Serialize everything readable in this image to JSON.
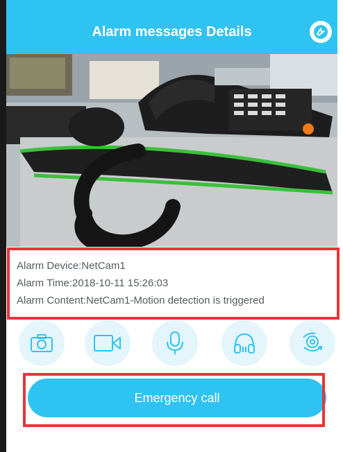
{
  "header": {
    "title": "Alarm messages Details",
    "action_icon": "edit-share-icon"
  },
  "camera": {
    "description_icon": "camera-snapshot"
  },
  "alarm": {
    "device": "Alarm Device:NetCam1",
    "time": "Alarm Time:2018-10-11 15:26:03",
    "content": "Alarm Content:NetCam1-Motion detection is triggered"
  },
  "toolbar": {
    "items": [
      {
        "name": "snapshot",
        "icon": "camera-icon"
      },
      {
        "name": "record",
        "icon": "video-icon"
      },
      {
        "name": "talk",
        "icon": "microphone-icon"
      },
      {
        "name": "listen",
        "icon": "headphones-icon"
      },
      {
        "name": "rotate",
        "icon": "rotate-camera-icon"
      }
    ]
  },
  "emergency": {
    "label": "Emergency call"
  },
  "colors": {
    "accent": "#2fc3f2",
    "highlight": "#e8343a",
    "tool_bg": "#e4f5fc"
  }
}
